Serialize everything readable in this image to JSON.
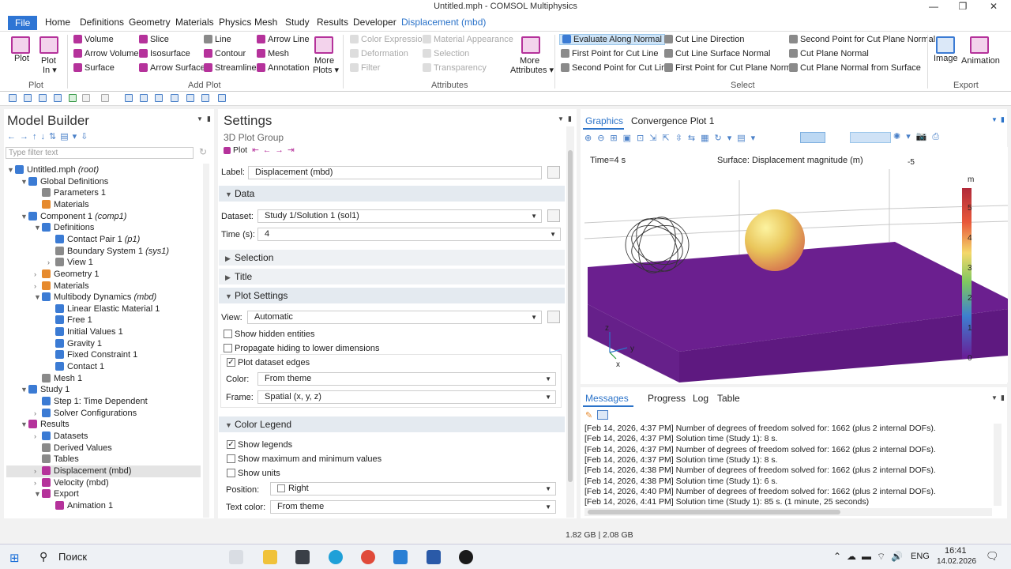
{
  "window": {
    "title": "Untitled.mph - COMSOL Multiphysics"
  },
  "menu": [
    "File",
    "Home",
    "Definitions",
    "Geometry",
    "Materials",
    "Physics",
    "Mesh",
    "Study",
    "Results",
    "Developer",
    "Displacement (mbd)"
  ],
  "ribbon": {
    "plot": {
      "plot": "Plot",
      "plot_in_1": "Plot",
      "plot_in_2": "In ▾",
      "group": "Plot"
    },
    "add_plot": {
      "volume": "Volume",
      "slice": "Slice",
      "line": "Line",
      "arrow_line": "Arrow Line",
      "arrow_volume": "Arrow Volume",
      "isosurface": "Isosurface",
      "contour": "Contour",
      "mesh": "Mesh",
      "surface": "Surface",
      "arrow_surface": "Arrow Surface",
      "streamline": "Streamline",
      "annotation": "Annotation",
      "more_plots_1": "More",
      "more_plots_2": "Plots ▾",
      "group": "Add Plot"
    },
    "attributes": {
      "color_expression": "Color Expression",
      "material_appearance": "Material Appearance",
      "deformation": "Deformation",
      "selection": "Selection",
      "filter": "Filter",
      "transparency": "Transparency",
      "more_1": "More",
      "more_2": "Attributes ▾",
      "group": "Attributes"
    },
    "select": {
      "evaluate_along_normal": "Evaluate Along Normal",
      "cut_line_direction": "Cut Line Direction",
      "second_point_cut_plane": "Second Point for Cut Plane Normal",
      "first_point_cut_line": "First Point for Cut Line",
      "cut_line_surface_normal": "Cut Line Surface Normal",
      "cut_plane_normal": "Cut Plane Normal",
      "second_point_cut_line": "Second Point for Cut Line",
      "first_point_cut_plane": "First Point for Cut Plane Normal",
      "cut_plane_normal_surface": "Cut Plane Normal from Surface",
      "group": "Select"
    },
    "export": {
      "image": "Image",
      "animation": "Animation",
      "group": "Export"
    }
  },
  "model_builder": {
    "title": "Model Builder",
    "filter_placeholder": "Type filter text",
    "tree": [
      {
        "label": "Untitled.mph",
        "italic": "(root)"
      },
      {
        "label": "Global Definitions"
      },
      {
        "label": "Parameters 1"
      },
      {
        "label": "Materials"
      },
      {
        "label": "Component 1",
        "italic": "(comp1)"
      },
      {
        "label": "Definitions"
      },
      {
        "label": "Contact Pair 1",
        "italic": "(p1)"
      },
      {
        "label": "Boundary System 1",
        "italic": "(sys1)"
      },
      {
        "label": "View 1"
      },
      {
        "label": "Geometry 1"
      },
      {
        "label": "Materials"
      },
      {
        "label": "Multibody Dynamics",
        "italic": "(mbd)"
      },
      {
        "label": "Linear Elastic Material 1"
      },
      {
        "label": "Free 1"
      },
      {
        "label": "Initial Values 1"
      },
      {
        "label": "Gravity 1"
      },
      {
        "label": "Fixed Constraint 1"
      },
      {
        "label": "Contact 1"
      },
      {
        "label": "Mesh 1"
      },
      {
        "label": "Study 1"
      },
      {
        "label": "Step 1: Time Dependent"
      },
      {
        "label": "Solver Configurations"
      },
      {
        "label": "Results"
      },
      {
        "label": "Datasets"
      },
      {
        "label": "Derived Values"
      },
      {
        "label": "Tables"
      },
      {
        "label": "Displacement (mbd)"
      },
      {
        "label": "Velocity (mbd)"
      },
      {
        "label": "Export"
      },
      {
        "label": "Animation 1"
      }
    ]
  },
  "settings": {
    "title": "Settings",
    "subtitle": "3D Plot Group",
    "crumb": "Plot",
    "label_caption": "Label:",
    "label_value": "Displacement (mbd)",
    "sections": {
      "data": "Data",
      "selection": "Selection",
      "title": "Title",
      "plot_settings": "Plot Settings",
      "color_legend": "Color Legend"
    },
    "dataset_caption": "Dataset:",
    "dataset_value": "Study 1/Solution 1 (sol1)",
    "time_caption": "Time (s):",
    "time_value": "4",
    "view_caption": "View:",
    "view_value": "Automatic",
    "show_hidden": "Show hidden entities",
    "propagate_hiding": "Propagate hiding to lower dimensions",
    "plot_dataset_edges": "Plot dataset edges",
    "color_caption": "Color:",
    "color_value": "From theme",
    "frame_caption": "Frame:",
    "frame_value": "Spatial  (x, y, z)",
    "show_legends": "Show legends",
    "show_maxmin": "Show maximum and minimum values",
    "show_units": "Show units",
    "position_caption": "Position:",
    "position_value": "Right",
    "text_color_caption": "Text color:",
    "text_color_value": "From theme"
  },
  "graphics": {
    "tab_graphics": "Graphics",
    "tab_convergence": "Convergence Plot 1",
    "time_label": "Time=4 s",
    "plot_title": "Surface: Displacement magnitude (m)",
    "corner_value": "-5",
    "unit": "m",
    "scale_ticks": [
      "5",
      "4",
      "3",
      "2",
      "1",
      "0"
    ],
    "axis_z": "z",
    "axis_y": "y",
    "axis_x": "x"
  },
  "messages": {
    "tabs": [
      "Messages",
      "Progress",
      "Log",
      "Table"
    ],
    "lines": [
      "[Feb 14, 2026, 4:37 PM] Number of degrees of freedom solved for: 1662 (plus 2 internal DOFs).",
      "[Feb 14, 2026, 4:37 PM] Solution time (Study 1): 8 s.",
      "[Feb 14, 2026, 4:37 PM] Number of degrees of freedom solved for: 1662 (plus 2 internal DOFs).",
      "[Feb 14, 2026, 4:37 PM] Solution time (Study 1): 8 s.",
      "[Feb 14, 2026, 4:38 PM] Number of degrees of freedom solved for: 1662 (plus 2 internal DOFs).",
      "[Feb 14, 2026, 4:38 PM] Solution time (Study 1): 6 s.",
      "[Feb 14, 2026, 4:40 PM] Number of degrees of freedom solved for: 1662 (plus 2 internal DOFs).",
      "[Feb 14, 2026, 4:41 PM] Solution time (Study 1): 85 s. (1 minute, 25 seconds)"
    ]
  },
  "status": {
    "memory": "1.82 GB | 2.08 GB"
  },
  "taskbar": {
    "search": "Поиск",
    "lang": "ENG",
    "time": "16:41",
    "date": "14.02.2026"
  }
}
